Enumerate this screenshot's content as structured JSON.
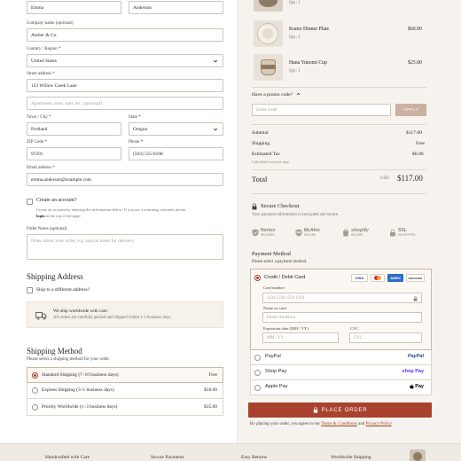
{
  "checkout": {
    "first_name": "Emma",
    "last_name": "Anderson",
    "company_label": "Company name (optional)",
    "company_value": "Atelier & Co.",
    "country_label": "Country / Region *",
    "country_value": "United States",
    "street_label": "Street address *",
    "street_value": "123 Willow Creek Lane",
    "apartment_placeholder": "Apartment, suite, unit, etc. (optional)",
    "city_label": "Town / City *",
    "city_value": "Portland",
    "state_label": "State *",
    "state_value": "Oregon",
    "zip_label": "ZIP Code *",
    "zip_value": "97201",
    "phone_label": "Phone *",
    "phone_value": "(503) 555-0198",
    "email_label": "Email address *",
    "email_value": "emma.anderson@example.com",
    "create_account_label": "Create an account?",
    "create_account_note_1": "Create an account by entering the information below. If you are a returning customer please",
    "create_account_note_2_bold": "login",
    "create_account_note_2_rest": " at the top of the page.",
    "order_notes_label": "Order Notes (optional)",
    "order_notes_placeholder": "Notes about your order, e.g. special notes for delivery."
  },
  "shipping_address": {
    "title": "Shipping Address",
    "ship_different_label": "Ship to a different address?",
    "notice_line_1": "We ship worldwide with care.",
    "notice_line_2": "All orders are carefully packed and shipped within 1-2 business days."
  },
  "shipping_method": {
    "title": "Shipping Method",
    "subtitle": "Please select a shipping method for your order.",
    "options": [
      {
        "label": "Standard Shipping (7–10 business days)",
        "price": "Free"
      },
      {
        "label": "Express Shipping (3–5 business days)",
        "price": "$18.00"
      },
      {
        "label": "Priority Worldwide (1–3 business days)",
        "price": "$35.00"
      }
    ]
  },
  "order_summary": {
    "items": [
      {
        "name": "",
        "qty": "Qty: 1",
        "price": ""
      },
      {
        "name": "Kumo Dinner Plate",
        "qty": "Qty: 2",
        "price": "$60.00"
      },
      {
        "name": "Hana Yunomi Cup",
        "qty": "Qty: 1",
        "price": "$25.00"
      }
    ],
    "promo_label": "Have a promo code?",
    "promo_placeholder": "Enter code",
    "apply_label": "APPLY",
    "subtotal_label": "Subtotal",
    "subtotal_value": "$117.00",
    "shipping_label": "Shipping",
    "shipping_value": "Free",
    "tax_label": "Estimated Tax",
    "tax_value": "$0.00",
    "tax_note": "Calculated at next step",
    "total_label": "Total",
    "total_currency": "USD",
    "total_value": "$117.00"
  },
  "secure": {
    "title": "Secure Checkout",
    "subtitle": "Your payment information is encrypted and secure.",
    "badges": [
      {
        "icon": "norton-shield-icon",
        "name": "Norton",
        "sub": "SECURED"
      },
      {
        "icon": "mcafee-shield-icon",
        "name": "McAfee",
        "sub": "SECURE"
      },
      {
        "icon": "shopify-bag-icon",
        "name": "shopify",
        "sub": "SECURE"
      },
      {
        "icon": "ssl-lock-icon",
        "name": "SSL",
        "sub": "ENCRYPTED"
      }
    ]
  },
  "payment": {
    "title": "Payment Method",
    "subtitle": "Please select a payment method.",
    "card_label": "Credit / Debit Card",
    "card_brands": [
      "VISA",
      "mastercard",
      "AMEX",
      "DISCOVER"
    ],
    "card_number_label": "Card number",
    "card_number_placeholder": "1234 1234 1234 1234",
    "name_label": "Name on card",
    "name_placeholder": "Emma Anderson",
    "expiry_label": "Expiration date (MM / YY)",
    "expiry_placeholder": "MM / YY",
    "cvc_label": "CVC",
    "cvc_placeholder": "CVC",
    "options": [
      {
        "label": "PayPal",
        "logo": "PayPal"
      },
      {
        "label": "Shop Pay",
        "logo": "shop Pay"
      },
      {
        "label": "Apple Pay",
        "logo": "Pay"
      }
    ],
    "place_order_label": "PLACE ORDER",
    "terms_prefix": "By placing your order, you agree to our ",
    "terms_link": "Terms & Conditions",
    "terms_and": " and ",
    "privacy_link": "Privacy Policy",
    "terms_suffix": "."
  },
  "footer": {
    "items": [
      "Handcrafted with Care",
      "Secure Payments",
      "Easy Returns",
      "Worldwide Shipping"
    ]
  },
  "colors": {
    "accent": "#a8412e",
    "apply_button": "#c9b2a2",
    "right_panel_bg": "#f6f3ee"
  }
}
